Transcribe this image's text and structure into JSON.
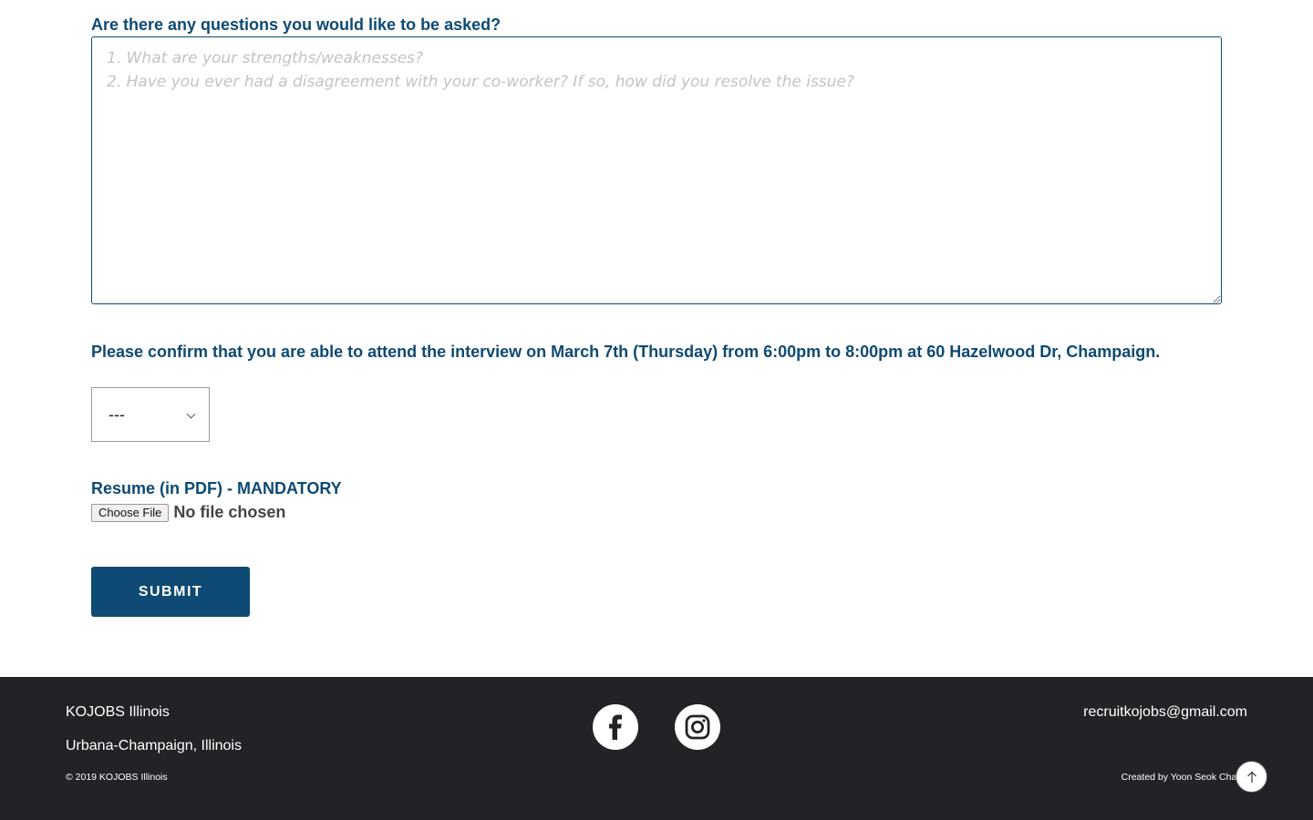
{
  "form": {
    "questions_label": "Are there any questions you would like to be asked?",
    "questions_placeholder": "1. What are your strengths/weaknesses?\n2. Have you ever had a disagreement with your co-worker? If so, how did you resolve the issue?",
    "confirm_label": "Please confirm that you are able to attend the interview on March 7th (Thursday) from 6:00pm to 8:00pm at 60 Hazelwood Dr, Champaign.",
    "confirm_selected": "---",
    "resume_label": "Resume (in PDF) - MANDATORY",
    "file_button": "Choose File",
    "file_status": "No file chosen",
    "submit_label": "SUBMIT"
  },
  "footer": {
    "org_name": "KOJOBS Illinois",
    "location": "Urbana-Champaign, Illinois",
    "copyright": "© 2019 KOJOBS Illinois",
    "email": "recruitkojobs@gmail.com",
    "credit": "Created by Yoon Seok Chang",
    "social": [
      "facebook-icon",
      "instagram-icon"
    ]
  },
  "colors": {
    "accent": "#0e4a73",
    "footer_bg": "#232226"
  }
}
